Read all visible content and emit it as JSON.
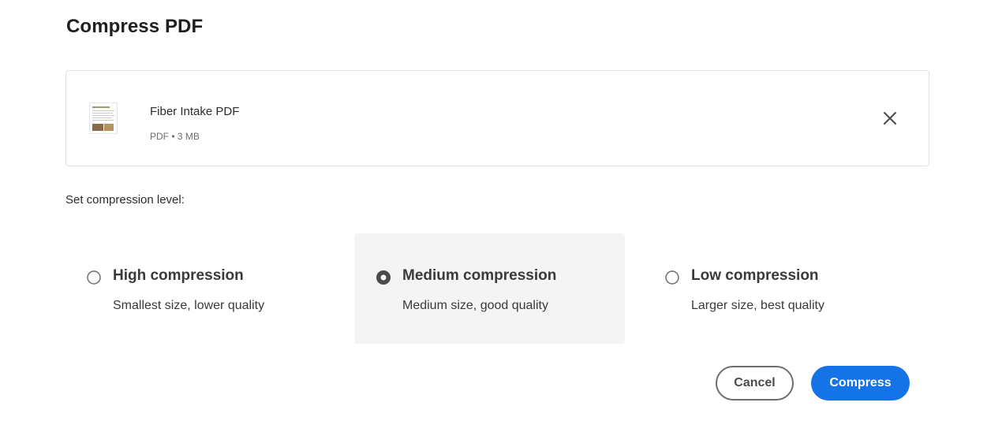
{
  "dialog": {
    "title": "Compress PDF"
  },
  "file": {
    "name": "Fiber Intake PDF",
    "meta": "PDF • 3 MB",
    "thumbnail_icon": "pdf-thumbnail-icon",
    "remove_icon": "close-icon"
  },
  "compression": {
    "label": "Set compression level:",
    "selected": "medium",
    "options": [
      {
        "id": "high",
        "title": "High compression",
        "description": "Smallest size, lower quality",
        "selected": false
      },
      {
        "id": "medium",
        "title": "Medium compression",
        "description": "Medium size, good quality",
        "selected": true
      },
      {
        "id": "low",
        "title": "Low compression",
        "description": "Larger size, best quality",
        "selected": false
      }
    ]
  },
  "actions": {
    "cancel_label": "Cancel",
    "compress_label": "Compress"
  },
  "colors": {
    "primary": "#1473e6",
    "selected_bg": "#f4f4f4",
    "border": "#e1e1e1"
  }
}
